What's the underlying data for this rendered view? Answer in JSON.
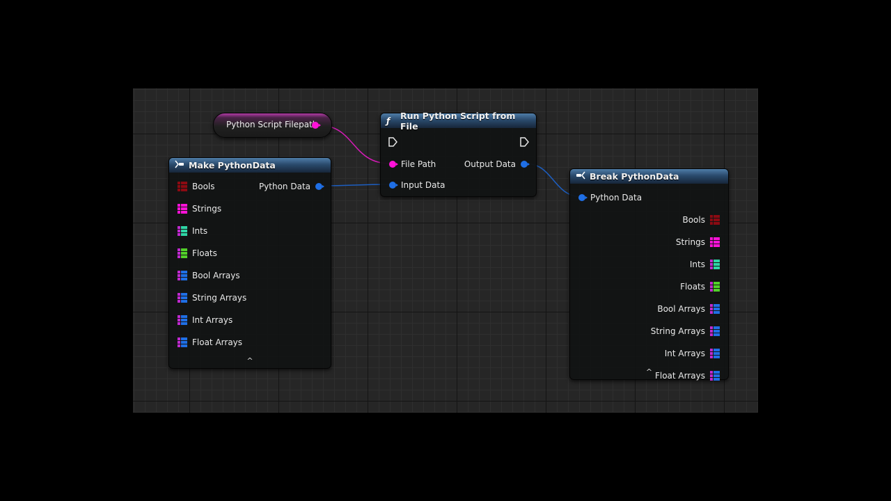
{
  "variable_node": {
    "label": "Python Script Filepath",
    "pin_color": "#ff12d8"
  },
  "run_node": {
    "title": "Run Python Script from File",
    "icon": "function-icon",
    "icon_glyph": "ƒ",
    "inputs": [
      "File Path",
      "Input Data"
    ],
    "outputs": [
      "Output Data"
    ]
  },
  "make_node": {
    "title": "Make PythonData",
    "icon": "make-struct-icon",
    "output": "Python Data",
    "pins": [
      "Bools",
      "Strings",
      "Ints",
      "Floats",
      "Bool Arrays",
      "String Arrays",
      "Int Arrays",
      "Float Arrays"
    ],
    "collapse_glyph": "^"
  },
  "break_node": {
    "title": "Break PythonData",
    "icon": "break-struct-icon",
    "input": "Python Data",
    "pins": [
      "Bools",
      "Strings",
      "Ints",
      "Floats",
      "Bool Arrays",
      "String Arrays",
      "Int Arrays",
      "Float Arrays"
    ],
    "collapse_glyph": "^"
  },
  "colors": {
    "struct_header": "#2a4a6c",
    "string_pin": "#ff12d8",
    "struct_pin": "#1f6fe6",
    "bool_pin": "#8b0a12",
    "int_pin": "#2fd6a6",
    "float_pin": "#52d02a",
    "array_pin": "#1f6fe6"
  }
}
